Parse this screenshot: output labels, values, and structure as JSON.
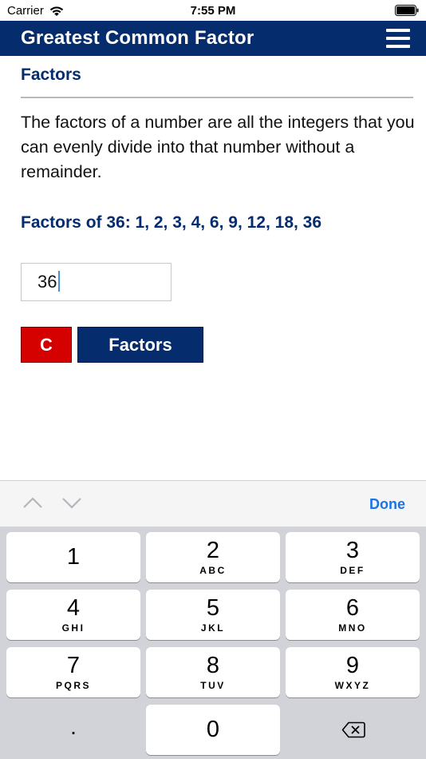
{
  "status_bar": {
    "carrier": "Carrier",
    "time": "7:55 PM",
    "wifi_icon": "wifi-icon",
    "battery_icon": "battery-icon"
  },
  "header": {
    "title": "Greatest Common Factor",
    "menu_icon": "hamburger-menu-icon",
    "background_color": "#052d6e"
  },
  "main": {
    "section_title": "Factors",
    "description": "The factors of a number are all the integers that you can evenly divide into that number without a remainder.",
    "result": "Factors of 36: 1, 2, 3, 4, 6, 9, 12, 18, 36",
    "input_value": "36",
    "clear_label": "C",
    "factors_label": "Factors",
    "accent_color": "#052d6e",
    "clear_color": "#d50000"
  },
  "keyboard": {
    "done_label": "Done",
    "prev_icon": "chevron-up-icon",
    "next_icon": "chevron-down-icon",
    "keys": [
      {
        "digit": "1",
        "letters": ""
      },
      {
        "digit": "2",
        "letters": "ABC"
      },
      {
        "digit": "3",
        "letters": "DEF"
      },
      {
        "digit": "4",
        "letters": "GHI"
      },
      {
        "digit": "5",
        "letters": "JKL"
      },
      {
        "digit": "6",
        "letters": "MNO"
      },
      {
        "digit": "7",
        "letters": "PQRS"
      },
      {
        "digit": "8",
        "letters": "TUV"
      },
      {
        "digit": "9",
        "letters": "WXYZ"
      },
      {
        "digit": "0",
        "letters": ""
      }
    ],
    "decimal_key": ".",
    "delete_icon": "backspace-icon"
  }
}
